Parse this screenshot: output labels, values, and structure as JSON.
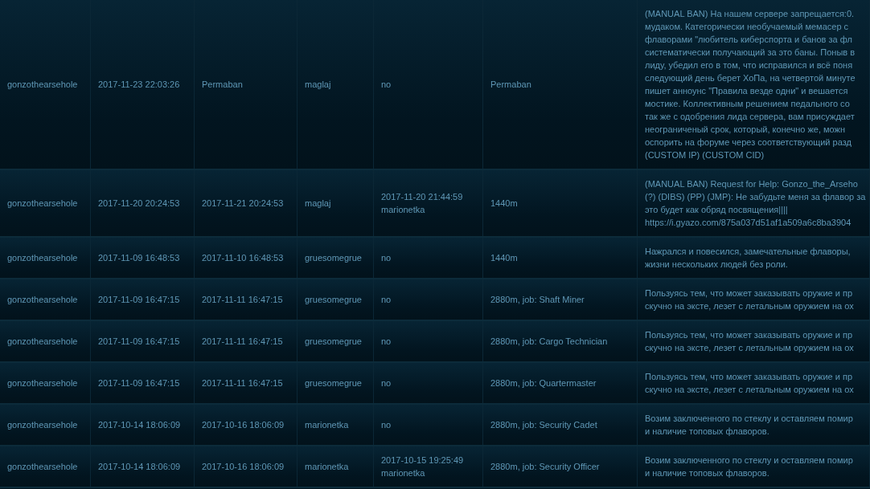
{
  "table": {
    "rows": [
      {
        "ckey": "gonzothearsehole",
        "ban_time": "2017-11-23 22:03:26",
        "expiry": "Permaban",
        "admin": "maglaj",
        "unbanned": [
          "no"
        ],
        "duration": "Permaban",
        "reason": [
          "(MANUAL BAN) На нашем сервере запрещается:0.",
          "мудаком. Категорически необучаемый мемасер с",
          "флаворами \"любитель киберспорта и банов за фл",
          "систематически получающий за это баны. Поныв в",
          "лиду, убедил его в том, что исправился и всё поня",
          "следующий день берет ХоПа, на четвертой минуте",
          "пишет анноунс \"Правила везде одни\" и вешается",
          "мостике. Коллективным решением педального со",
          "так же с одобрения лида сервера, вам присуждает",
          "неограниченый срок, который, конечно же, можн",
          "оспорить на форуме через соответствующий разд",
          "(CUSTOM IP) (CUSTOM CID)"
        ]
      },
      {
        "ckey": "gonzothearsehole",
        "ban_time": "2017-11-20 20:24:53",
        "expiry": "2017-11-21 20:24:53",
        "admin": "maglaj",
        "unbanned": [
          "2017-11-20 21:44:59",
          "marionetka"
        ],
        "duration": "1440m",
        "reason": [
          "(MANUAL BAN) Request for Help: Gonzo_the_Arseho",
          "(?) (DIBS) (PP) (JMP): Не забудьте меня за флавор за",
          "это будет как обряд посвящения||||",
          "https://i.gyazo.com/875a037d51af1a509a6c8ba3904"
        ]
      },
      {
        "ckey": "gonzothearsehole",
        "ban_time": "2017-11-09 16:48:53",
        "expiry": "2017-11-10 16:48:53",
        "admin": "gruesomegrue",
        "unbanned": [
          "no"
        ],
        "duration": "1440m",
        "reason": [
          "Нажрался и повесился, замечательные флаворы,",
          "жизни нескольких людей без роли."
        ]
      },
      {
        "ckey": "gonzothearsehole",
        "ban_time": "2017-11-09 16:47:15",
        "expiry": "2017-11-11 16:47:15",
        "admin": "gruesomegrue",
        "unbanned": [
          "no"
        ],
        "duration": "2880m, job: Shaft Miner",
        "reason": [
          "Пользуясь тем, что может заказывать оружие и пр",
          "скучно на эксте, лезет с летальным оружием на ох"
        ]
      },
      {
        "ckey": "gonzothearsehole",
        "ban_time": "2017-11-09 16:47:15",
        "expiry": "2017-11-11 16:47:15",
        "admin": "gruesomegrue",
        "unbanned": [
          "no"
        ],
        "duration": "2880m, job: Cargo Technician",
        "reason": [
          "Пользуясь тем, что может заказывать оружие и пр",
          "скучно на эксте, лезет с летальным оружием на ох"
        ]
      },
      {
        "ckey": "gonzothearsehole",
        "ban_time": "2017-11-09 16:47:15",
        "expiry": "2017-11-11 16:47:15",
        "admin": "gruesomegrue",
        "unbanned": [
          "no"
        ],
        "duration": "2880m, job: Quartermaster",
        "reason": [
          "Пользуясь тем, что может заказывать оружие и пр",
          "скучно на эксте, лезет с летальным оружием на ох"
        ]
      },
      {
        "ckey": "gonzothearsehole",
        "ban_time": "2017-10-14 18:06:09",
        "expiry": "2017-10-16 18:06:09",
        "admin": "marionetka",
        "unbanned": [
          "no"
        ],
        "duration": "2880m, job: Security Cadet",
        "reason": [
          "Возим заключенного по стеклу и оставляем помир",
          "и наличие топовых флаворов."
        ]
      },
      {
        "ckey": "gonzothearsehole",
        "ban_time": "2017-10-14 18:06:09",
        "expiry": "2017-10-16 18:06:09",
        "admin": "marionetka",
        "unbanned": [
          "2017-10-15 19:25:49",
          "marionetka"
        ],
        "duration": "2880m, job: Security Officer",
        "reason": [
          "Возим заключенного по стеклу и оставляем помир",
          "и наличие топовых флаворов."
        ]
      }
    ]
  }
}
